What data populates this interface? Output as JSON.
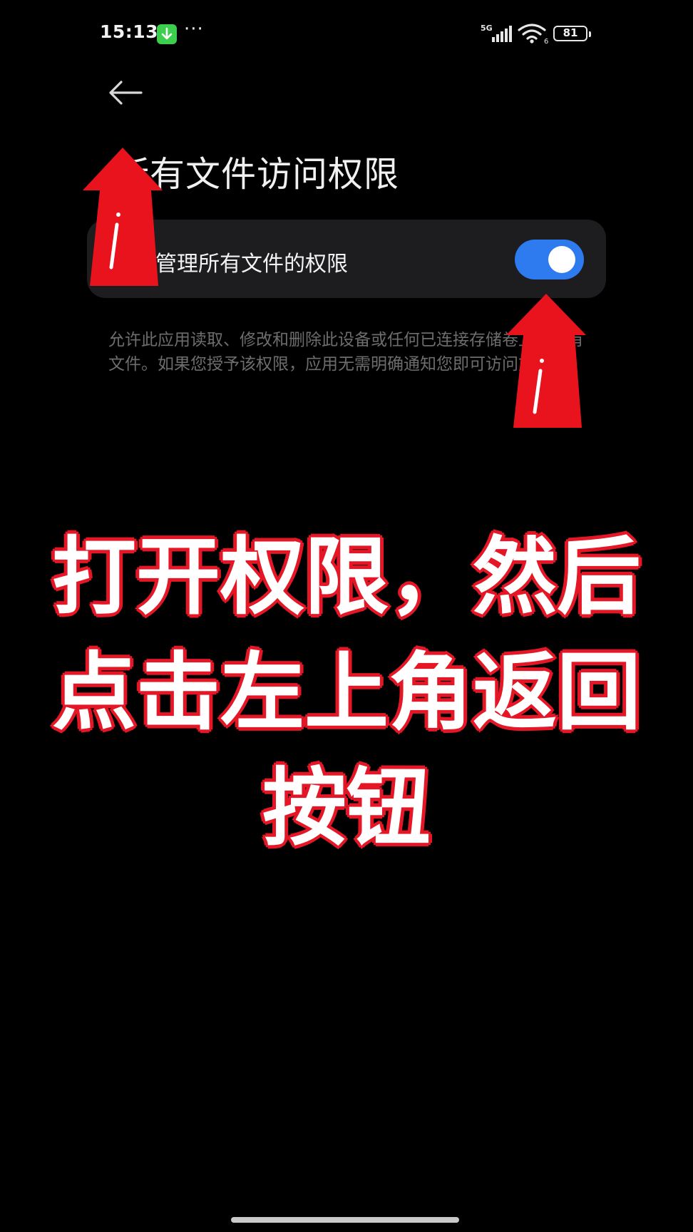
{
  "status_bar": {
    "time": "15:13",
    "network": "5G",
    "wifi_sub": "6",
    "battery": "81",
    "more": "···",
    "colors": {
      "download_badge": "#3ccf4e"
    }
  },
  "header": {
    "back_icon": "back-arrow-icon",
    "title": "所有文件访问权限"
  },
  "setting": {
    "label": "管理所有文件的权限",
    "toggle_on": true,
    "accent": "#2e7bf0"
  },
  "description": "允许此应用读取、修改和删除此设备或任何已连接存储卷上的所有文件。如果您授予该权限，应用无需明确通知您即可访问文件。",
  "overlay": {
    "lines": [
      "打开权限，然后",
      "点击左上角返回",
      "按钮"
    ],
    "stroke_color": "#e51726"
  },
  "annotations": {
    "arrow_color": "#e8131d",
    "arrow_icons": [
      "red-arrow-icon",
      "red-arrow-icon"
    ]
  }
}
